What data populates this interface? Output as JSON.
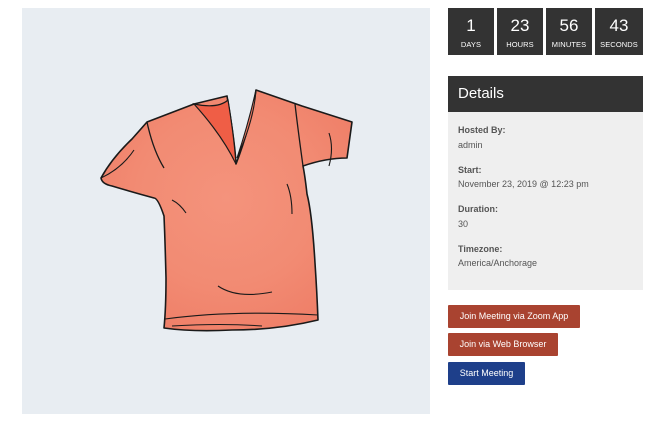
{
  "countdown": {
    "days": {
      "value": "1",
      "label": "DAYS"
    },
    "hours": {
      "value": "23",
      "label": "HOURS"
    },
    "minutes": {
      "value": "56",
      "label": "MINUTES"
    },
    "seconds": {
      "value": "43",
      "label": "SECONDS"
    }
  },
  "details": {
    "title": "Details",
    "hosted_by": {
      "label": "Hosted By:",
      "value": "admin"
    },
    "start": {
      "label": "Start:",
      "value": "November 23, 2019 @ 12:23 pm"
    },
    "duration": {
      "label": "Duration:",
      "value": "30"
    },
    "timezone": {
      "label": "Timezone:",
      "value": "America/Anchorage"
    }
  },
  "actions": {
    "join_zoom_app": "Join Meeting via Zoom App",
    "join_web_browser": "Join via Web Browser",
    "start_meeting": "Start Meeting"
  },
  "image": {
    "subject": "t-shirt-illustration",
    "shirt_color": "#f28b73",
    "background_color": "#e8edf2"
  }
}
